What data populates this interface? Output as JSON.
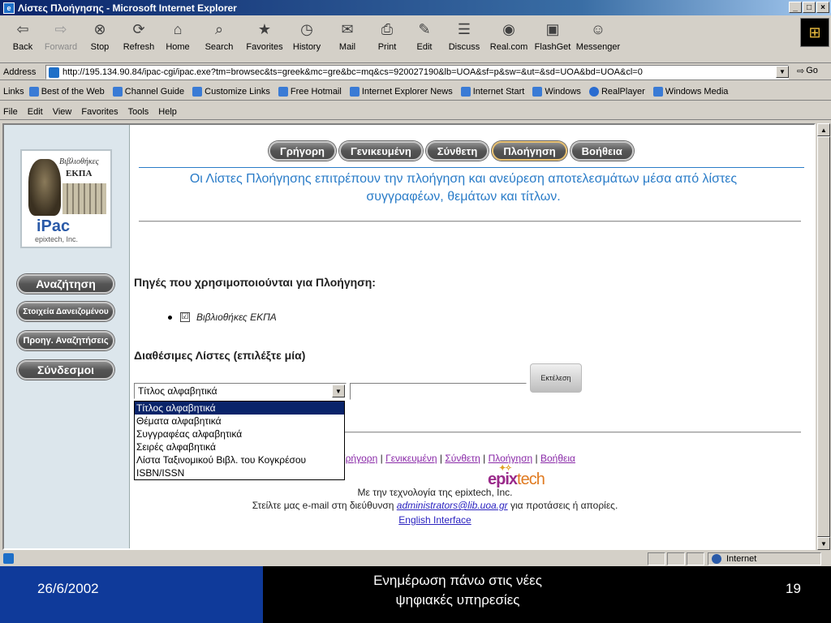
{
  "window": {
    "title": "Λίστες Πλοήγησης - Microsoft Internet Explorer"
  },
  "toolbar": [
    {
      "label": "Back",
      "icon": "⇦",
      "disabled": false,
      "dropdown": true
    },
    {
      "label": "Forward",
      "icon": "⇨",
      "disabled": true,
      "dropdown": true
    },
    {
      "label": "Stop",
      "icon": "⊗"
    },
    {
      "label": "Refresh",
      "icon": "⟳"
    },
    {
      "label": "Home",
      "icon": "⌂"
    },
    {
      "label": "Search",
      "icon": "⌕"
    },
    {
      "label": "Favorites",
      "icon": "★"
    },
    {
      "label": "History",
      "icon": "◷"
    },
    {
      "label": "Mail",
      "icon": "✉"
    },
    {
      "label": "Print",
      "icon": "⎙"
    },
    {
      "label": "Edit",
      "icon": "✎"
    },
    {
      "label": "Discuss",
      "icon": "☰"
    },
    {
      "label": "Real.com",
      "icon": "◉"
    },
    {
      "label": "FlashGet",
      "icon": "▣"
    },
    {
      "label": "Messenger",
      "icon": "☺"
    }
  ],
  "address": {
    "label": "Address",
    "url": "http://195.134.90.84/ipac-cgi/ipac.exe?tm=browsec&ts=greek&mc=gre&bc=mq&cs=920027190&lb=UOA&sf=p&sw=&ut=&sd=UOA&bd=UOA&cl=0",
    "go_label": "Go"
  },
  "links": {
    "label": "Links",
    "items": [
      "Best of the Web",
      "Channel Guide",
      "Customize Links",
      "Free Hotmail",
      "Internet Explorer News",
      "Internet Start",
      "Windows",
      "RealPlayer",
      "Windows Media"
    ]
  },
  "menu": [
    "File",
    "Edit",
    "View",
    "Favorites",
    "Tools",
    "Help"
  ],
  "logo": {
    "line1": "Βιβλιοθήκες",
    "line2": "ΕΚΠΑ",
    "brand": "iPac",
    "vendor": "epixtech, Inc."
  },
  "sidebar": {
    "buttons": [
      "Αναζήτηση",
      "Στοιχεία Δανειζομένου",
      "Προηγ. Αναζητήσεις",
      "Σύνδεσμοι"
    ]
  },
  "tabs": [
    {
      "label": "Γρήγορη",
      "active": false
    },
    {
      "label": "Γενικευμένη",
      "active": false
    },
    {
      "label": "Σύνθετη",
      "active": false
    },
    {
      "label": "Πλοήγηση",
      "active": true
    },
    {
      "label": "Βοήθεια",
      "active": false
    }
  ],
  "main": {
    "tagline_1": "Οι Λίστες Πλοήγησης επιτρέπουν την πλοήγηση και ανεύρεση αποτελεσμάτων μέσα από λίστες",
    "tagline_2": "συγγραφέων, θεμάτων και τίτλων.",
    "sources_heading": "Πηγές που χρησιμοποιούνται για Πλοήγηση:",
    "source_item": "Βιβλιοθήκες ΕΚΠΑ",
    "source_checked": "☑",
    "lists_heading": "Διαθέσιμες Λίστες (επιλέξτε μία)",
    "selected_list": "Τίτλος αλφαβητικά",
    "list_options": [
      "Τίτλος αλφαβητικά",
      "Θέματα αλφαβητικά",
      "Συγγραφέας αλφαβητικά",
      "Σειρές αλφαβητικά",
      "Λίστα Ταξινομικού Βιβλ. του Κογκρέσου",
      "ISBN/ISSN"
    ],
    "search_value": "",
    "execute_label": "Εκτέλεση"
  },
  "footer": {
    "nav_links": [
      "Γρήγορη",
      "Γενικευμένη",
      "Σύνθετη",
      "Πλοήγηση",
      "Βοήθεια"
    ],
    "tech_text": "Με την τεχνολογία της epixtech, Inc.",
    "epix_logo_a": "epix",
    "epix_logo_b": "tech",
    "contact_prefix": "Στείλτε μας e-mail στη διεύθυνση",
    "contact_email": "administrators@lib.uoa.gr",
    "contact_suffix": "για προτάσεις ή απορίες.",
    "english": "English Interface"
  },
  "statusbar": {
    "zone": "Internet"
  },
  "slide": {
    "date": "26/6/2002",
    "title_1": "Ενημέρωση πάνω στις νέες",
    "title_2": "ψηφιακές υπηρεσίες",
    "page": "19"
  },
  "colors": {
    "accent_link": "#2a22c0",
    "tagline": "#2a7cc8",
    "slide_left": "#0f3a9a"
  }
}
